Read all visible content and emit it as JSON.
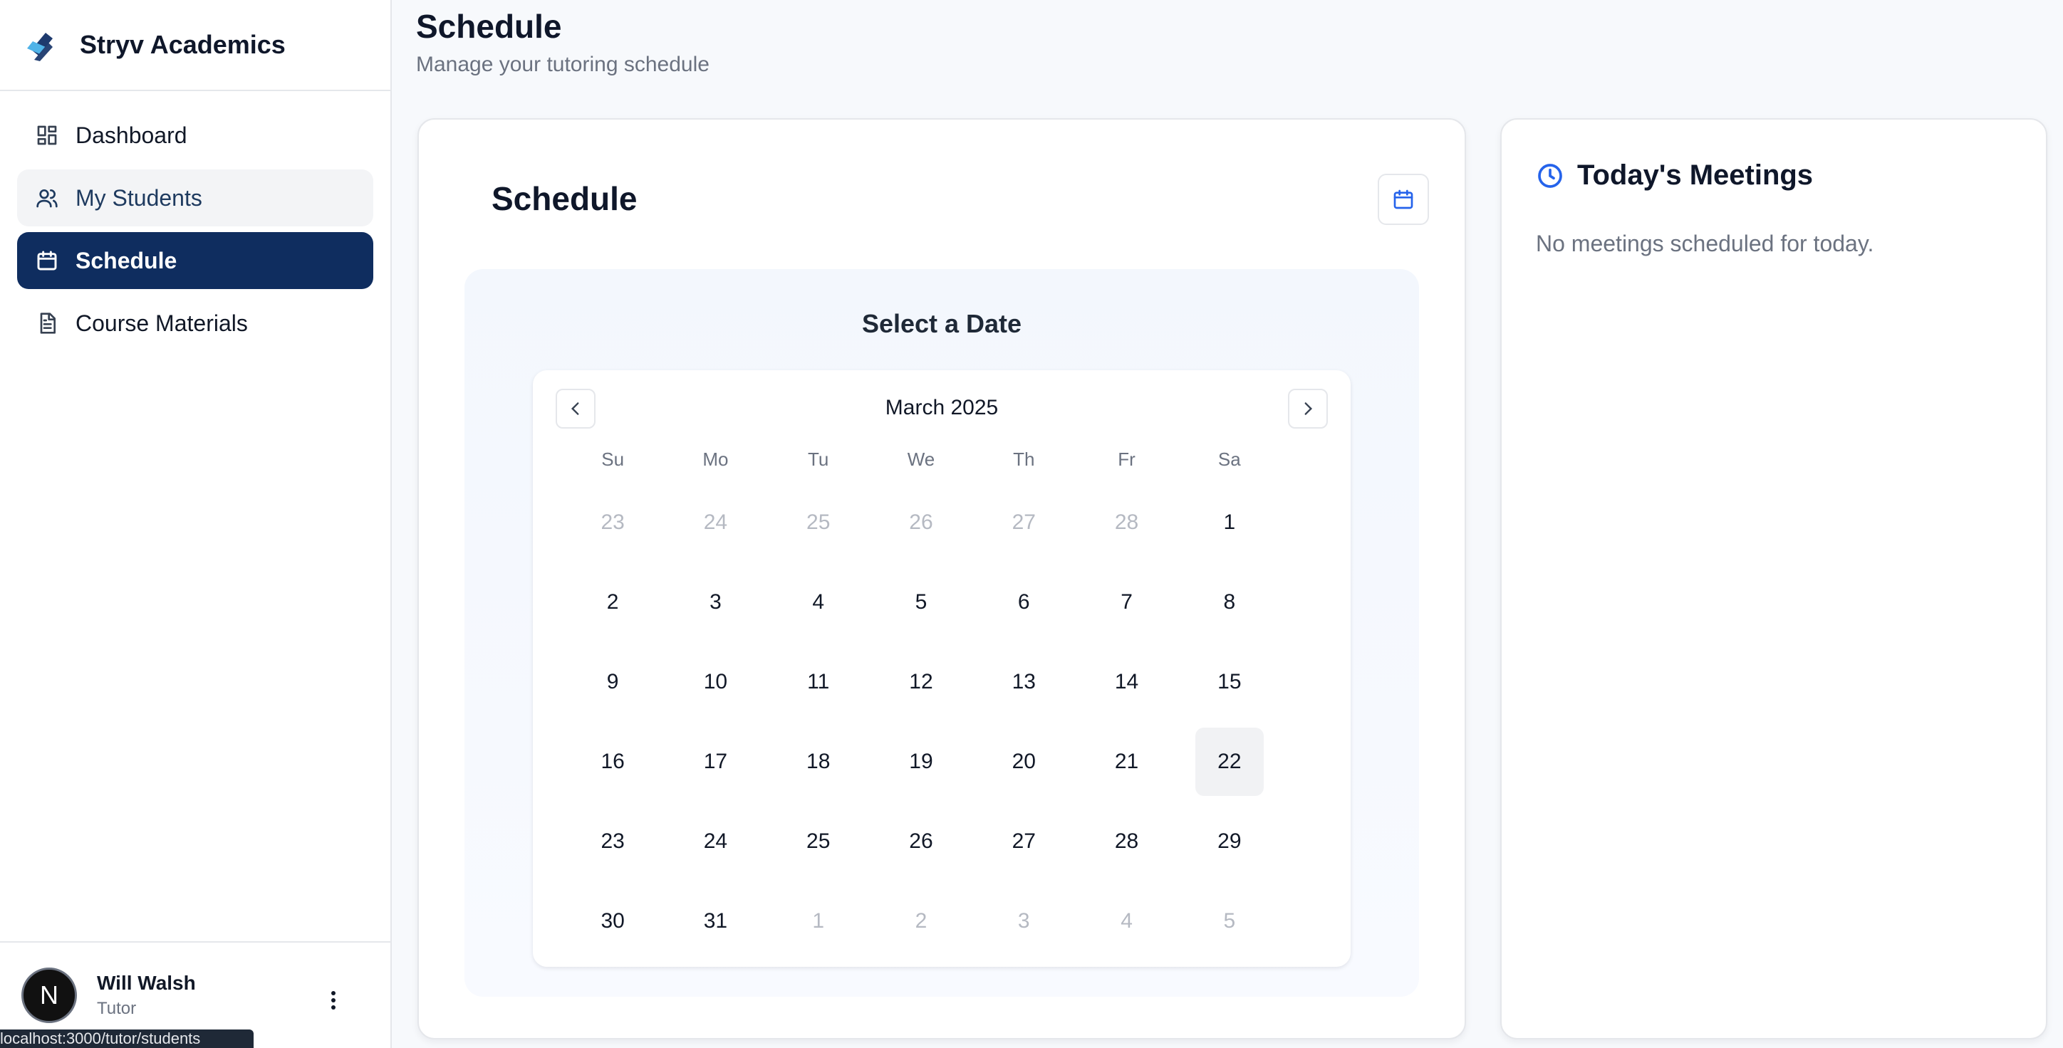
{
  "sidebar": {
    "brand": "Stryv Academics",
    "nav": [
      {
        "label": "Dashboard"
      },
      {
        "label": "My Students"
      },
      {
        "label": "Schedule"
      },
      {
        "label": "Course Materials"
      }
    ],
    "user": {
      "initial": "N",
      "name": "Will Walsh",
      "role": "Tutor"
    },
    "status_url": "localhost:3000/tutor/students"
  },
  "header": {
    "title": "Schedule",
    "subtitle": "Manage your tutoring schedule"
  },
  "schedule_card": {
    "title": "Schedule",
    "picker_heading": "Select a Date",
    "calendar": {
      "month": "March 2025",
      "weekdays": [
        "Su",
        "Mo",
        "Tu",
        "We",
        "Th",
        "Fr",
        "Sa"
      ],
      "weeks": [
        [
          {
            "d": "23",
            "m": true
          },
          {
            "d": "24",
            "m": true
          },
          {
            "d": "25",
            "m": true
          },
          {
            "d": "26",
            "m": true
          },
          {
            "d": "27",
            "m": true
          },
          {
            "d": "28",
            "m": true
          },
          {
            "d": "1"
          }
        ],
        [
          {
            "d": "2"
          },
          {
            "d": "3"
          },
          {
            "d": "4"
          },
          {
            "d": "5"
          },
          {
            "d": "6"
          },
          {
            "d": "7"
          },
          {
            "d": "8"
          }
        ],
        [
          {
            "d": "9"
          },
          {
            "d": "10"
          },
          {
            "d": "11"
          },
          {
            "d": "12"
          },
          {
            "d": "13"
          },
          {
            "d": "14"
          },
          {
            "d": "15"
          }
        ],
        [
          {
            "d": "16"
          },
          {
            "d": "17"
          },
          {
            "d": "18"
          },
          {
            "d": "19"
          },
          {
            "d": "20"
          },
          {
            "d": "21"
          },
          {
            "d": "22",
            "today": true
          }
        ],
        [
          {
            "d": "23"
          },
          {
            "d": "24"
          },
          {
            "d": "25"
          },
          {
            "d": "26"
          },
          {
            "d": "27"
          },
          {
            "d": "28"
          },
          {
            "d": "29"
          }
        ],
        [
          {
            "d": "30"
          },
          {
            "d": "31"
          },
          {
            "d": "1",
            "m": true
          },
          {
            "d": "2",
            "m": true
          },
          {
            "d": "3",
            "m": true
          },
          {
            "d": "4",
            "m": true
          },
          {
            "d": "5",
            "m": true
          }
        ]
      ]
    }
  },
  "meetings_card": {
    "title": "Today's Meetings",
    "empty_text": "No meetings scheduled for today."
  },
  "colors": {
    "primary": "#0f2d5f",
    "accent_blue": "#2563eb",
    "logo_dark": "#1e3a6e",
    "logo_light": "#4fb3e8"
  },
  "icons": {
    "dashboard": "dashboard-grid-icon",
    "students": "users-icon",
    "schedule": "calendar-icon",
    "materials": "document-icon",
    "meetings": "clock-icon"
  }
}
